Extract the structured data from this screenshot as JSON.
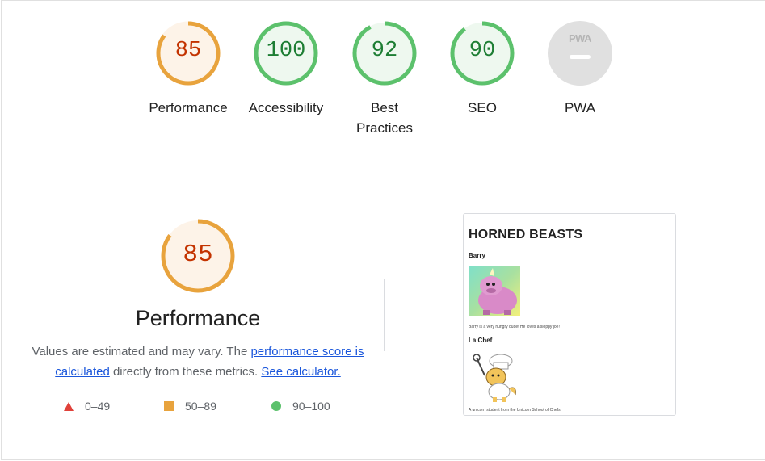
{
  "categories": [
    {
      "id": "performance",
      "label": "Performance",
      "score": "85",
      "fraction": 0.85,
      "color": "#e8a33d"
    },
    {
      "id": "accessibility",
      "label": "Accessibility",
      "score": "100",
      "fraction": 1.0,
      "color": "#5cc16c"
    },
    {
      "id": "best-practices",
      "label": "Best Practices",
      "score": "92",
      "fraction": 0.92,
      "color": "#5cc16c"
    },
    {
      "id": "seo",
      "label": "SEO",
      "score": "90",
      "fraction": 0.9,
      "color": "#5cc16c"
    }
  ],
  "pwa": {
    "label": "PWA",
    "badge_text": "PWA"
  },
  "performance_section": {
    "score": "85",
    "fraction": 0.85,
    "title": "Performance",
    "desc_part1": "Values are estimated and may vary. The ",
    "link1": "performance score is calculated",
    "desc_part2": " directly from these metrics. ",
    "link2": "See calculator."
  },
  "legend": [
    {
      "shape": "triangle",
      "range": "0–49",
      "color": "#e0413a"
    },
    {
      "shape": "square",
      "range": "50–89",
      "color": "#e8a33d"
    },
    {
      "shape": "circle",
      "range": "90–100",
      "color": "#5cc16c"
    }
  ],
  "thumbnail": {
    "title": "HORNED BEASTS",
    "beast1_name": "Barry",
    "beast1_caption": "Barry is a very hungry dude! He loves a sloppy joe!",
    "beast2_name": "La Chef",
    "beast2_caption": "A unicorn student from the Unicorn School of Chefs"
  },
  "colors": {
    "orange": "#e8a33d",
    "green": "#5cc16c",
    "orange_text": "#c33300",
    "green_text": "#1e7e34",
    "link": "#1a56db"
  }
}
